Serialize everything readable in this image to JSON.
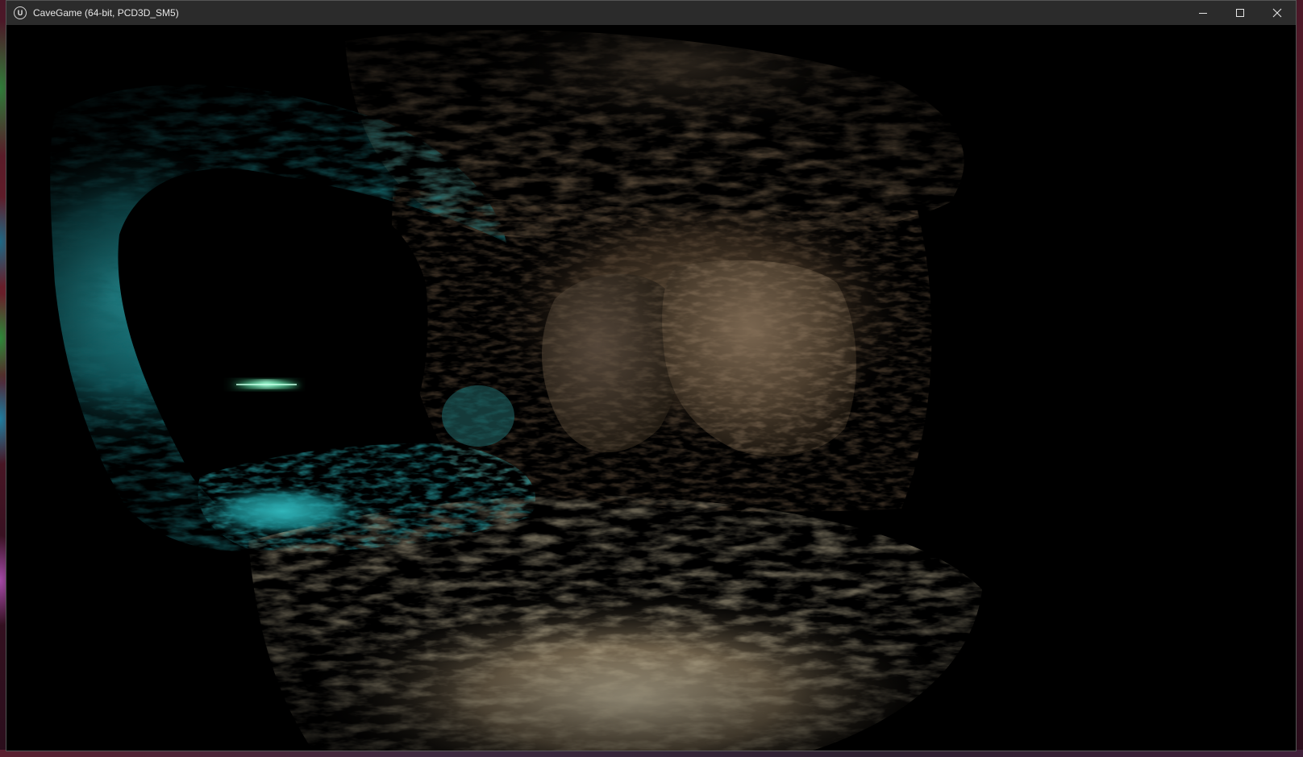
{
  "window": {
    "title": "CaveGame (64-bit, PCD3D_SM5)",
    "app_icon_glyph": "U",
    "controls": {
      "minimize_icon": "minimize-icon",
      "maximize_icon": "maximize-icon",
      "close_icon": "close-icon"
    }
  },
  "scene": {
    "description_kind": "3d-cave-render",
    "colors": {
      "background": "#000000",
      "cyan_light": "#1fa3a8",
      "rock_brown": "#6a5640",
      "rock_highlight": "#b0a48c",
      "glow_green": "#4dffb0"
    }
  }
}
